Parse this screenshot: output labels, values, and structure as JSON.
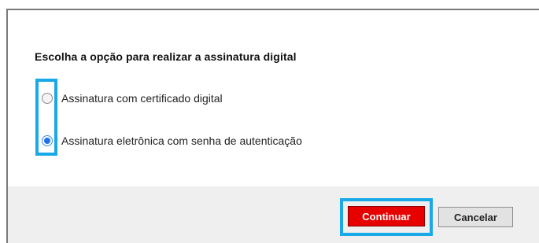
{
  "dialog": {
    "title": "Escolha a opção para realizar a assinatura digital",
    "options": [
      {
        "label": "Assinatura com certificado digital",
        "selected": false
      },
      {
        "label": "Assinatura eletrônica com senha de autenticação",
        "selected": true
      }
    ],
    "buttons": {
      "continue_label": "Continuar",
      "cancel_label": "Cancelar"
    }
  },
  "colors": {
    "highlight": "#1aa9e8",
    "primary_button": "#e60000",
    "radio_selected": "#1e73e8",
    "footer_bg": "#efefef"
  }
}
